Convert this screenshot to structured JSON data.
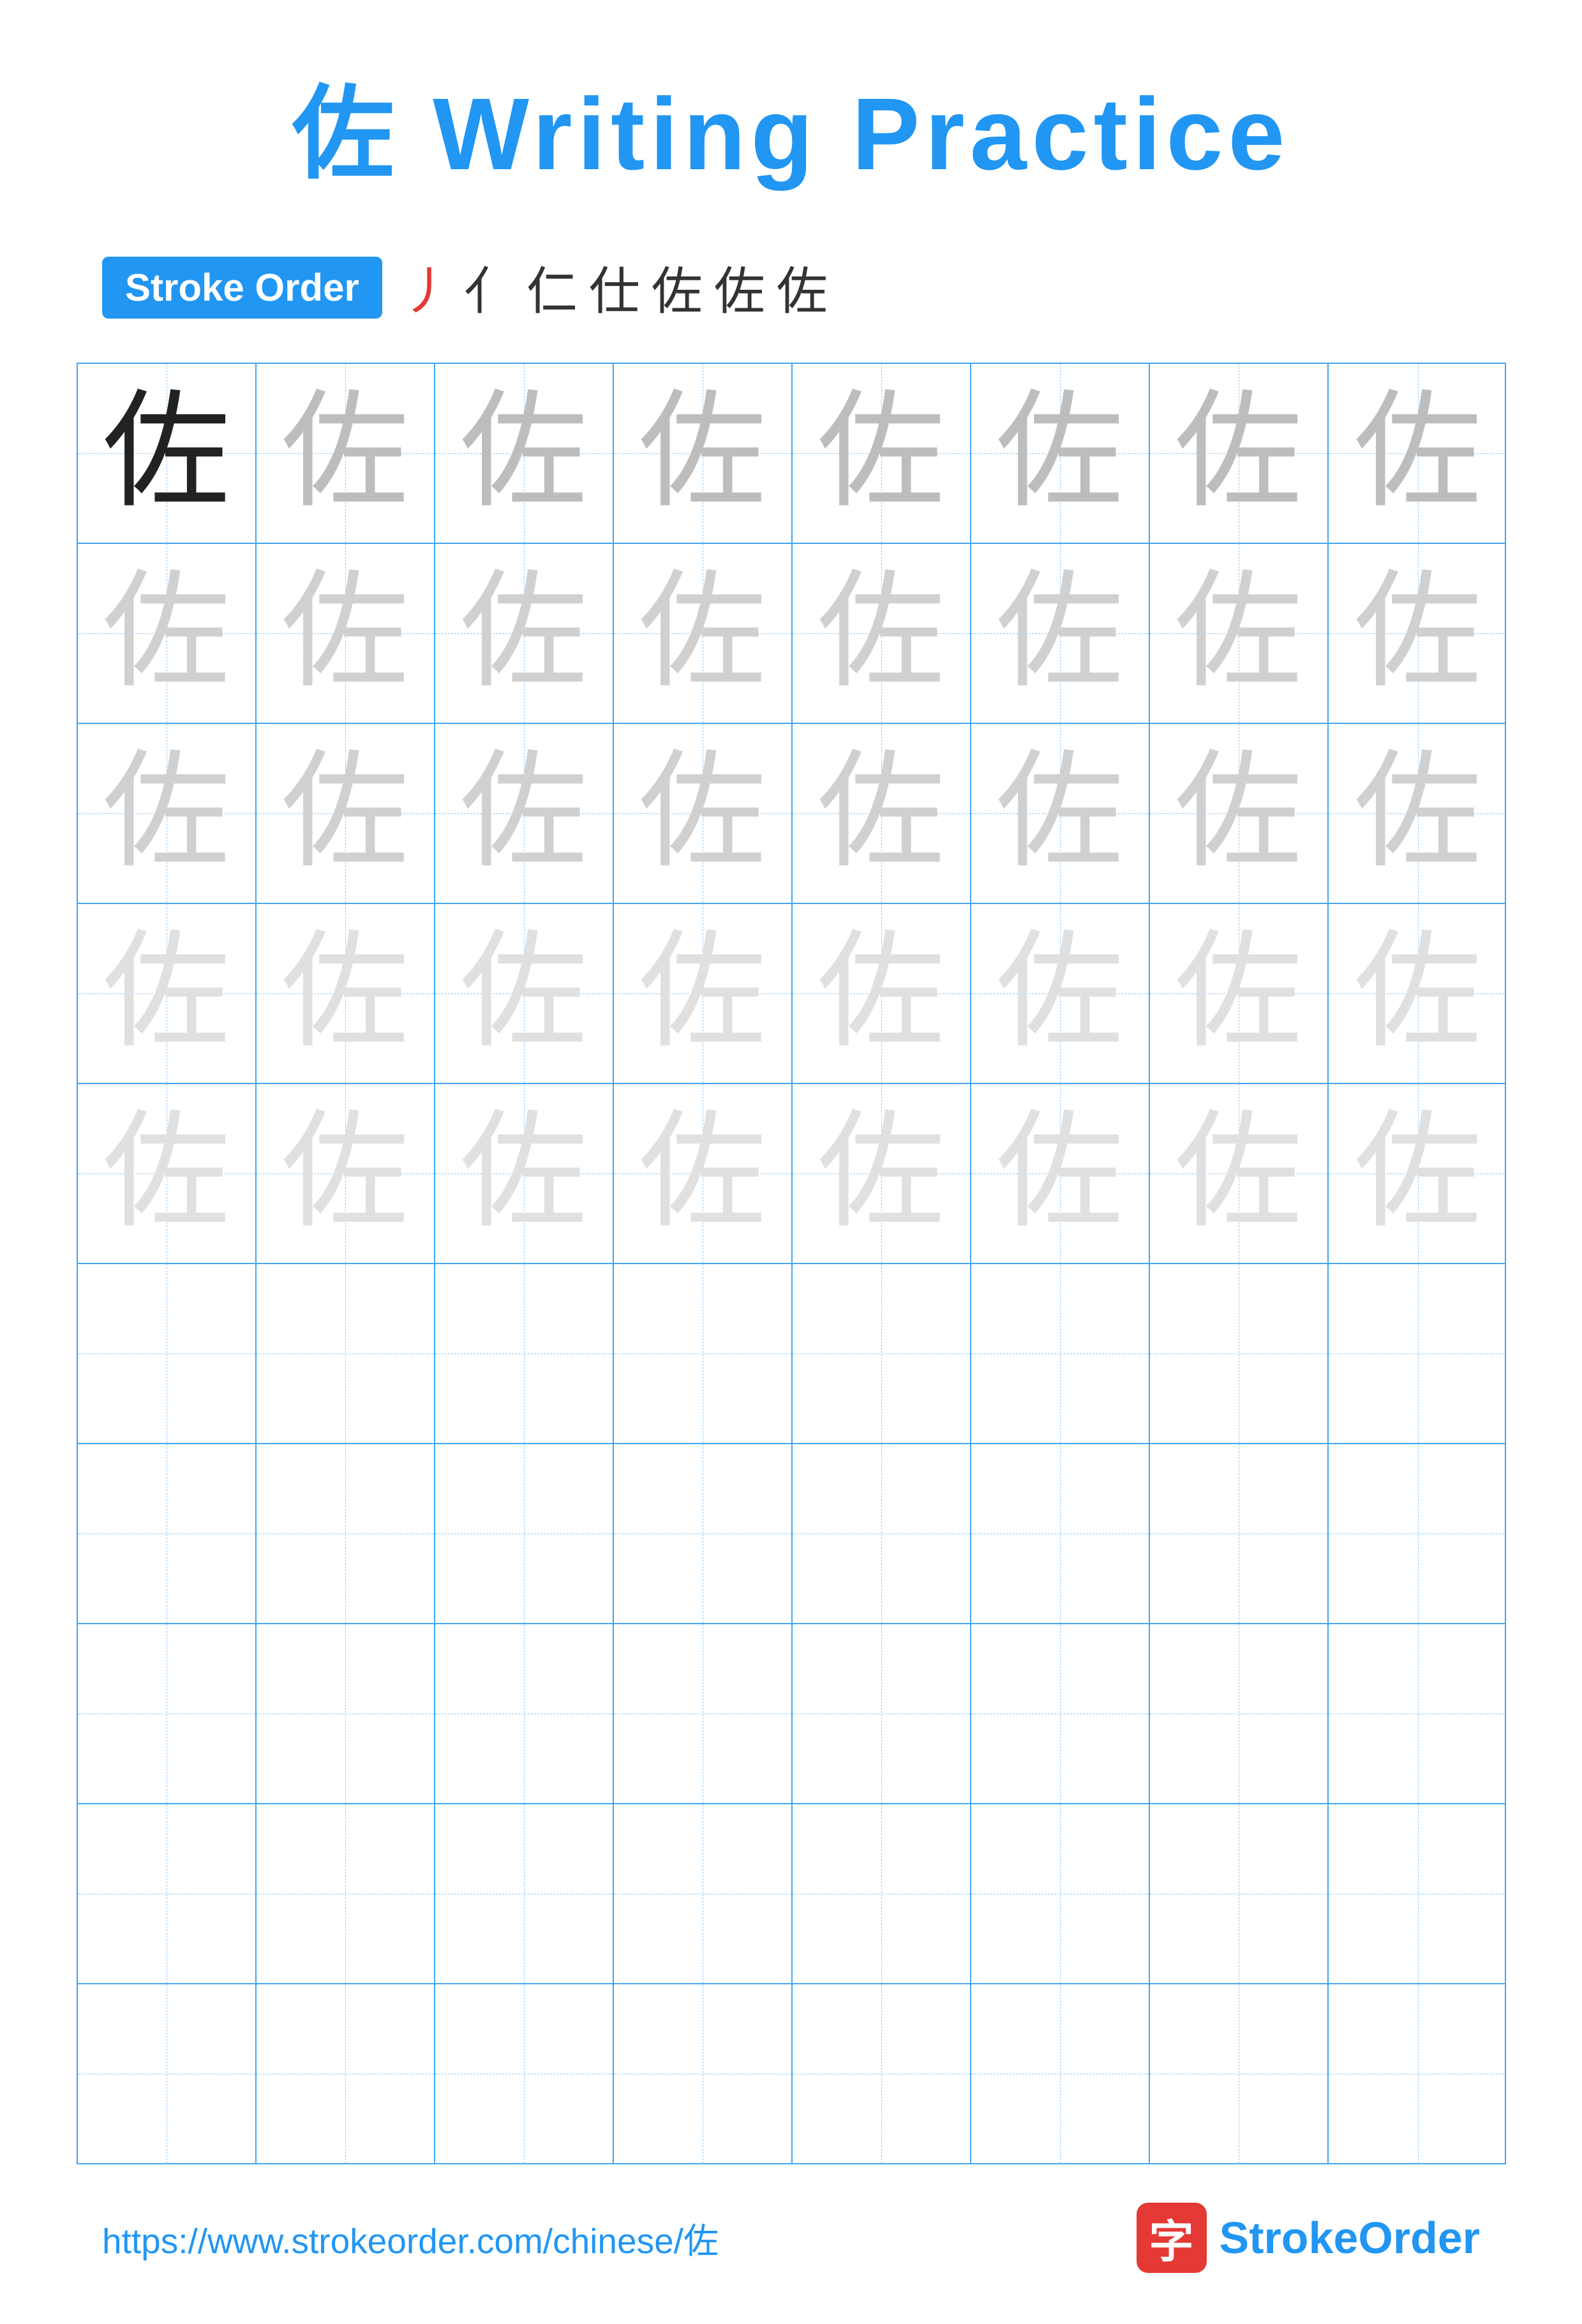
{
  "title": "佐 Writing Practice",
  "strokeOrder": {
    "label": "Stroke Order",
    "chars": [
      "丿",
      "亻",
      "仁",
      "仕",
      "佐",
      "佐",
      "佐"
    ]
  },
  "character": "佐",
  "grid": {
    "rows": 10,
    "cols": 8,
    "practiceRows": 5,
    "emptyRows": 5
  },
  "footer": {
    "url": "https://www.strokeorder.com/chinese/佐",
    "logoChar": "字",
    "brandName": "StrokeOrder"
  }
}
